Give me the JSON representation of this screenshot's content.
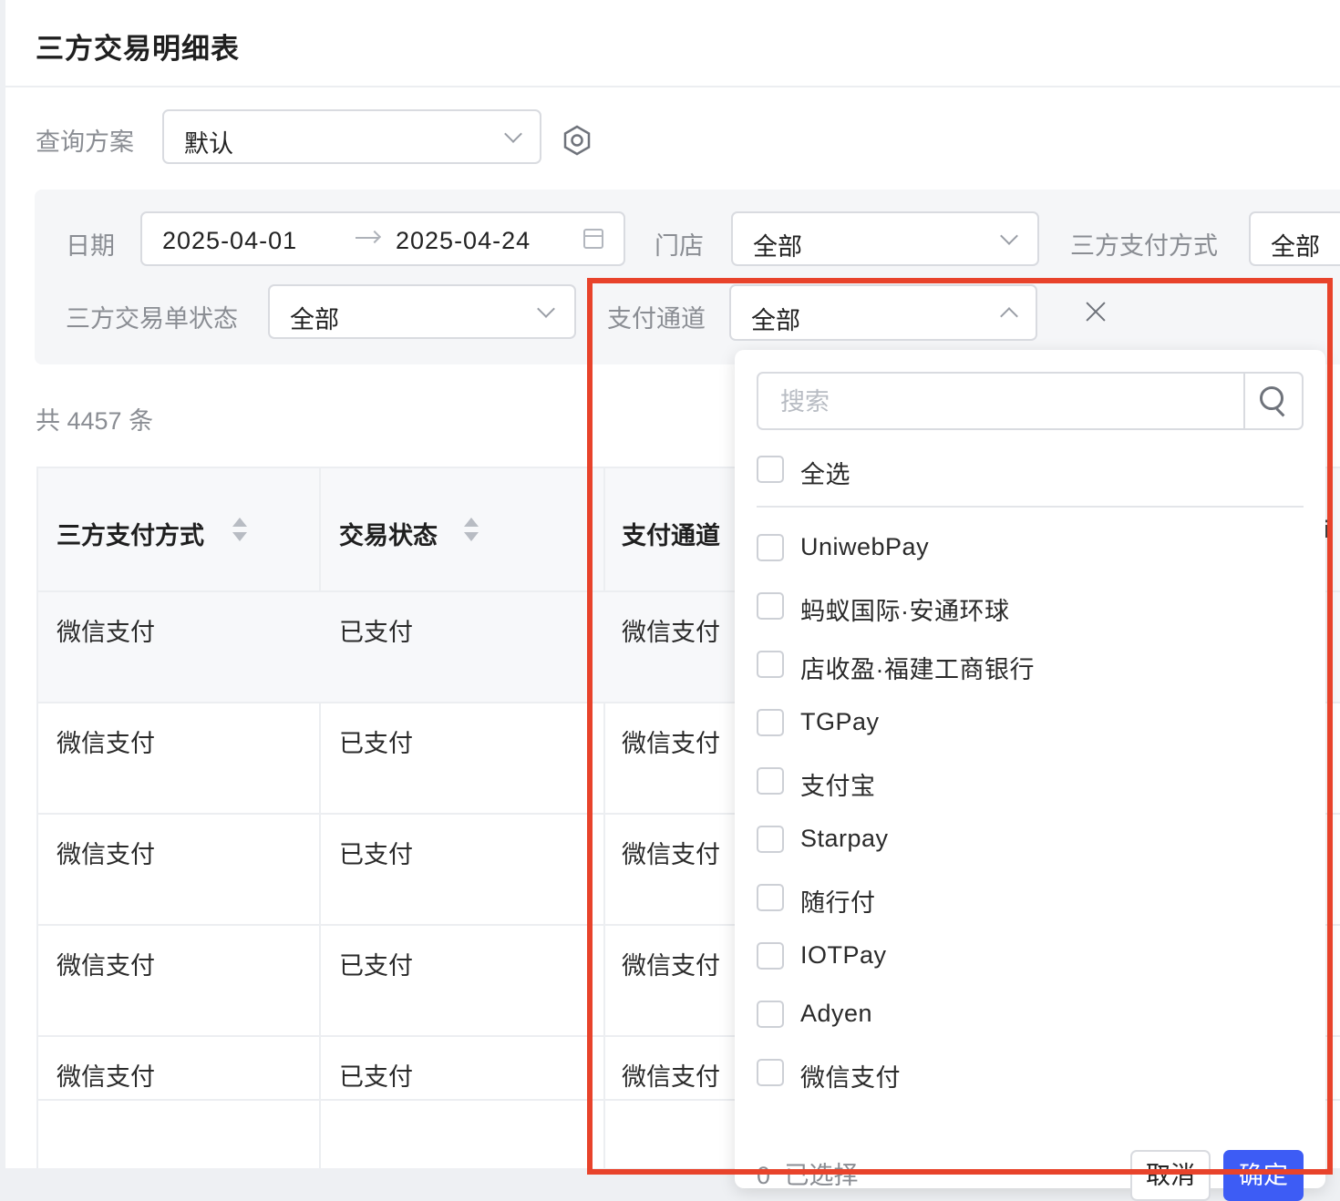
{
  "page": {
    "title": "三方交易明细表"
  },
  "query_plan": {
    "label": "查询方案",
    "value": "默认"
  },
  "filters": {
    "date": {
      "label": "日期",
      "start": "2025-04-01",
      "end": "2025-04-24"
    },
    "store": {
      "label": "门店",
      "value": "全部"
    },
    "third_party_pay_method": {
      "label": "三方支付方式",
      "value": "全部"
    },
    "order_status": {
      "label": "三方交易单状态",
      "value": "全部"
    },
    "pay_channel": {
      "label": "支付通道",
      "value": "全部"
    }
  },
  "summary": {
    "total_text": "共 4457 条"
  },
  "table": {
    "columns": [
      "三方支付方式",
      "交易状态",
      "支付通道"
    ],
    "rows": [
      [
        "微信支付",
        "已支付",
        "微信支付"
      ],
      [
        "微信支付",
        "已支付",
        "微信支付"
      ],
      [
        "微信支付",
        "已支付",
        "微信支付"
      ],
      [
        "微信支付",
        "已支付",
        "微信支付"
      ],
      [
        "微信支付",
        "已支付",
        "微信支付"
      ]
    ]
  },
  "dropdown": {
    "search_placeholder": "搜索",
    "select_all_label": "全选",
    "options": [
      "UniwebPay",
      "蚂蚁国际·安通环球",
      "店收盈·福建工商银行",
      "TGPay",
      "支付宝",
      "Starpay",
      "随行付",
      "IOTPay",
      "Adyen",
      "微信支付"
    ],
    "selected_count": "0",
    "selected_suffix": "已选择",
    "cancel_label": "取消",
    "confirm_label": "确定"
  },
  "colors": {
    "accent": "#3d5cf5",
    "highlight": "#e8432b"
  }
}
